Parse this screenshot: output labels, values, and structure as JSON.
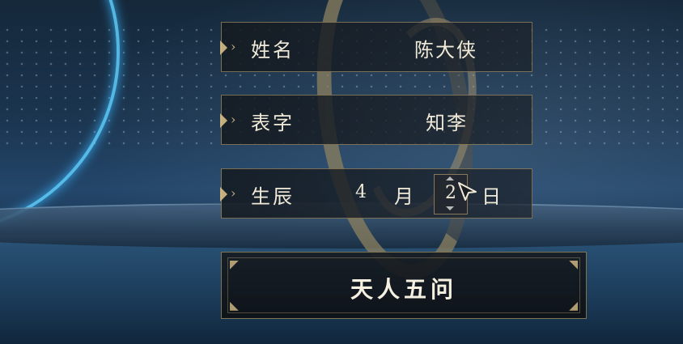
{
  "form": {
    "name": {
      "label": "姓名",
      "value": "陈大侠"
    },
    "courtesy": {
      "label": "表字",
      "value": "知李"
    },
    "birth": {
      "label": "生辰",
      "month": "4",
      "month_unit": "月",
      "day": "2",
      "day_unit": "日"
    }
  },
  "action": {
    "label": "天人五问"
  },
  "icons": {
    "field_marker": "chevron-right-icon",
    "stepper": "up-down-arrows-icon",
    "pointer": "cursor-icon"
  },
  "colors": {
    "accent_gold": "#c8af78",
    "text": "#f1ead9",
    "glow_blue": "#5fd0ff"
  }
}
